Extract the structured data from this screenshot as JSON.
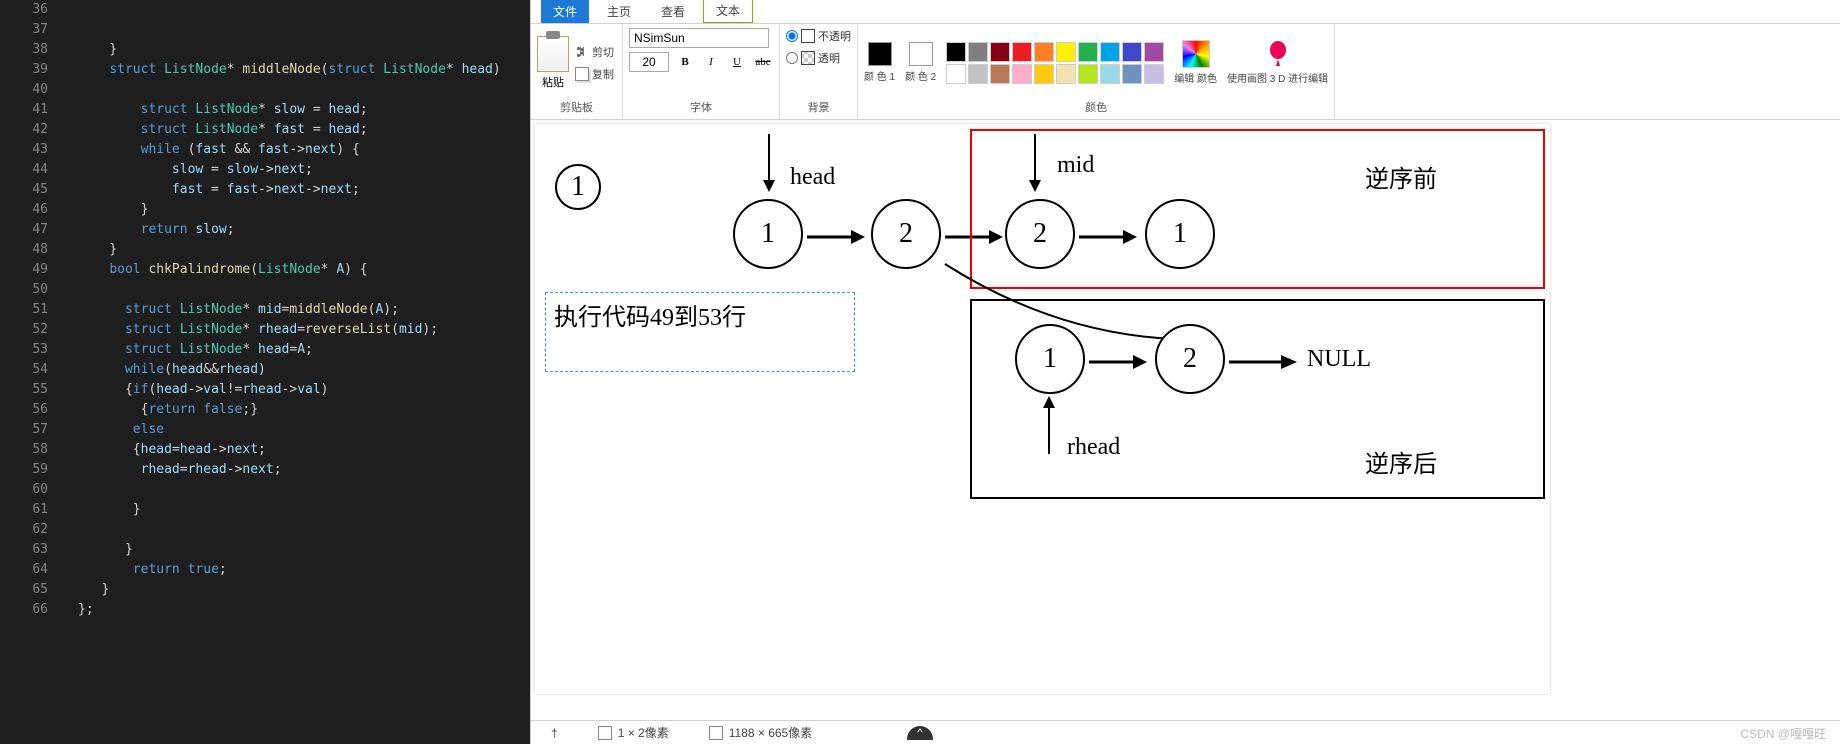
{
  "editor": {
    "line_start": 36,
    "lines": [
      "",
      "",
      "    }",
      "    struct ListNode* middleNode(struct ListNode* head)",
      "",
      "        struct ListNode* slow = head;",
      "        struct ListNode* fast = head;",
      "        while (fast && fast->next) {",
      "            slow = slow->next;",
      "            fast = fast->next->next;",
      "        }",
      "        return slow;",
      "    }",
      "    bool chkPalindrome(ListNode* A) {",
      "",
      "      struct ListNode* mid=middleNode(A);",
      "      struct ListNode* rhead=reverseList(mid);",
      "      struct ListNode* head=A;",
      "      while(head&&rhead)",
      "      {if(head->val!=rhead->val)",
      "        {return false;}",
      "       else",
      "       {head=head->next;",
      "        rhead=rhead->next;",
      "",
      "       }",
      "",
      "      }",
      "       return true;",
      "   }",
      "};"
    ]
  },
  "paint": {
    "tabs": {
      "file": "文件",
      "home": "主页",
      "view": "查看",
      "text": "文本"
    },
    "clipboard": {
      "paste": "粘贴",
      "cut": "剪切",
      "copy": "复制",
      "label": "剪贴板"
    },
    "font": {
      "name": "NSimSun",
      "size": "20",
      "label": "字体",
      "bold": "B",
      "italic": "I",
      "underline": "U",
      "strike": "abc"
    },
    "background": {
      "opaque": "不透明",
      "transparent": "透明",
      "label": "背景"
    },
    "colors": {
      "c1_label": "颜\n色 1",
      "c2_label": "颜\n色 2",
      "edit_label": "编辑\n颜色",
      "paint3d_label": "使用画图 3\nD 进行编辑",
      "label": "颜色"
    },
    "palette": [
      "#000000",
      "#7f7f7f",
      "#880015",
      "#ed1c24",
      "#ff7f27",
      "#fff200",
      "#22b14c",
      "#00a2e8",
      "#3f48cc",
      "#a349a4",
      "#ffffff",
      "#c3c3c3",
      "#b97a57",
      "#ffaec9",
      "#ffc90e",
      "#efe4b0",
      "#b5e61d",
      "#99d9ea",
      "#7092be",
      "#c8bfe7"
    ],
    "canvas": {
      "text_edit": "执行代码49到53行",
      "head": "head",
      "mid": "mid",
      "rhead": "rhead",
      "null": "NULL",
      "before": "逆序前",
      "after": "逆序后",
      "n1": "1",
      "n2": "2"
    },
    "status": {
      "cursor": "†",
      "sel": "1 × 2像素",
      "dim": "1188 × 665像素"
    }
  },
  "watermark": "CSDN @嘎嘎旺"
}
